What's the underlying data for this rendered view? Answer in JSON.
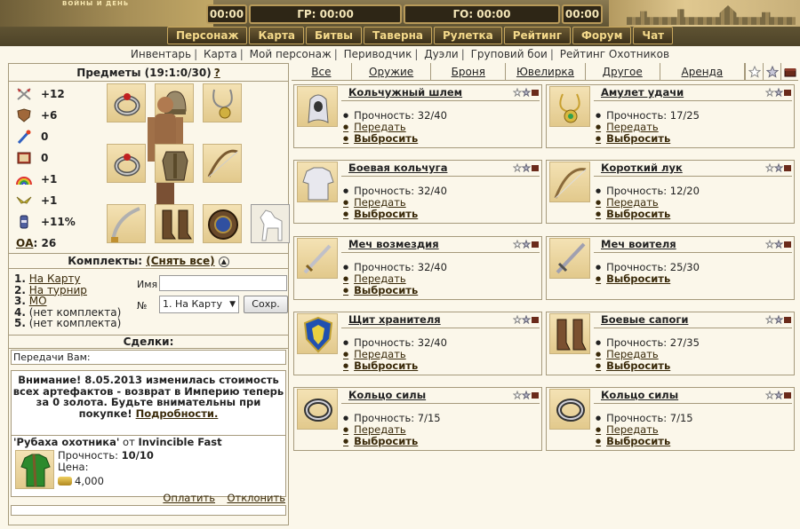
{
  "header": {
    "logo_text": "ВОЙНЫ И ДЕНЬ",
    "timers": {
      "t1": "00:00",
      "gr": "ГР: 00:00",
      "go": "ГО: 00:00",
      "t2": "00:00"
    }
  },
  "nav": [
    "Персонаж",
    "Карта",
    "Битвы",
    "Таверна",
    "Рулетка",
    "Рейтинг",
    "Форум",
    "Чат"
  ],
  "submenu": [
    "Инвентарь",
    "Карта",
    "Мой персонаж",
    "Периводчик",
    "Дуэли",
    "Груповий бои",
    "Рейтинг Охотников"
  ],
  "left": {
    "title": "Предметы (19:1:0/30)",
    "help": "?",
    "stats": [
      {
        "icon": "crossed-swords-icon",
        "value": "+12"
      },
      {
        "icon": "shield-icon",
        "value": "+6"
      },
      {
        "icon": "wand-icon",
        "value": "0"
      },
      {
        "icon": "book-icon",
        "value": "0"
      },
      {
        "icon": "rainbow-icon",
        "value": "+1"
      },
      {
        "icon": "wings-icon",
        "value": "+1"
      },
      {
        "icon": "potion-icon",
        "value": "+11%"
      }
    ],
    "oa_label": "ОА",
    "oa_value": ": 26",
    "kompl": {
      "title": "Комплекты:",
      "reset": "(Снять все)",
      "items": [
        {
          "num": "1.",
          "label": "На Карту",
          "link": true
        },
        {
          "num": "2.",
          "label": "На турнир",
          "link": true
        },
        {
          "num": "3.",
          "label": "МО",
          "link": true
        },
        {
          "num": "4.",
          "label": "(нет комплекта)",
          "link": false
        },
        {
          "num": "5.",
          "label": "(нет комплекта)",
          "link": false
        }
      ],
      "name_label": "Имя",
      "num_label": "№",
      "select_value": "1. На Карту",
      "save_button": "Сохр."
    },
    "deals": {
      "title": "Сделки:",
      "transfers": "Передачи Вам:",
      "notice_text": "Внимание! 8.05.2013 изменилась стоимость всех артефактов - возврат в Империю теперь за 0 золота. Будьте внимательны при покупке! ",
      "notice_link": "Подробности.",
      "item_name": "'Рубаха охотника'",
      "item_from": " от ",
      "item_seller": "Invincible Fast",
      "durability_label": "Прочность: ",
      "durability_value": "10/10",
      "price_label": "Цена:",
      "price_value": "4,000",
      "pay": "Оплатить",
      "decline": "Отклонить"
    }
  },
  "tabs": [
    "Все",
    "Оружие",
    "Броня",
    "Ювелирка",
    "Другое",
    "Аренда"
  ],
  "items": [
    {
      "name": "Кольчужный шлем",
      "durability": "Прочность: 32/40",
      "give": "Передать",
      "drop": "Выбросить",
      "icon": "helmet-icon"
    },
    {
      "name": "Амулет удачи",
      "durability": "Прочность: 17/25",
      "give": "Передать",
      "drop": "Выбросить",
      "icon": "amulet-icon"
    },
    {
      "name": "Боевая кольчуга",
      "durability": "Прочность: 32/40",
      "give": "Передать",
      "drop": "Выбросить",
      "icon": "chainmail-icon"
    },
    {
      "name": "Короткий лук",
      "durability": "Прочность: 12/20",
      "give": "Передать",
      "drop": "Выбросить",
      "icon": "bow-icon"
    },
    {
      "name": "Меч возмездия",
      "durability": "Прочность: 32/40",
      "give": "Передать",
      "drop": "Выбросить",
      "icon": "sword-icon"
    },
    {
      "name": "Меч воителя",
      "durability": "Прочность: 25/30",
      "give": "",
      "drop": "Выбросить",
      "icon": "sword-icon"
    },
    {
      "name": "Щит хранителя",
      "durability": "Прочность: 32/40",
      "give": "Передать",
      "drop": "Выбросить",
      "icon": "shield-item-icon"
    },
    {
      "name": "Боевые сапоги",
      "durability": "Прочность: 27/35",
      "give": "Передать",
      "drop": "Выбросить",
      "icon": "boots-icon"
    },
    {
      "name": "Кольцо силы",
      "durability": "Прочность: 7/15",
      "give": "Передать",
      "drop": "Выбросить",
      "icon": "ring-icon"
    },
    {
      "name": "Кольцо силы",
      "durability": "Прочность: 7/15",
      "give": "Передать",
      "drop": "Выбросить",
      "icon": "ring-icon"
    }
  ]
}
